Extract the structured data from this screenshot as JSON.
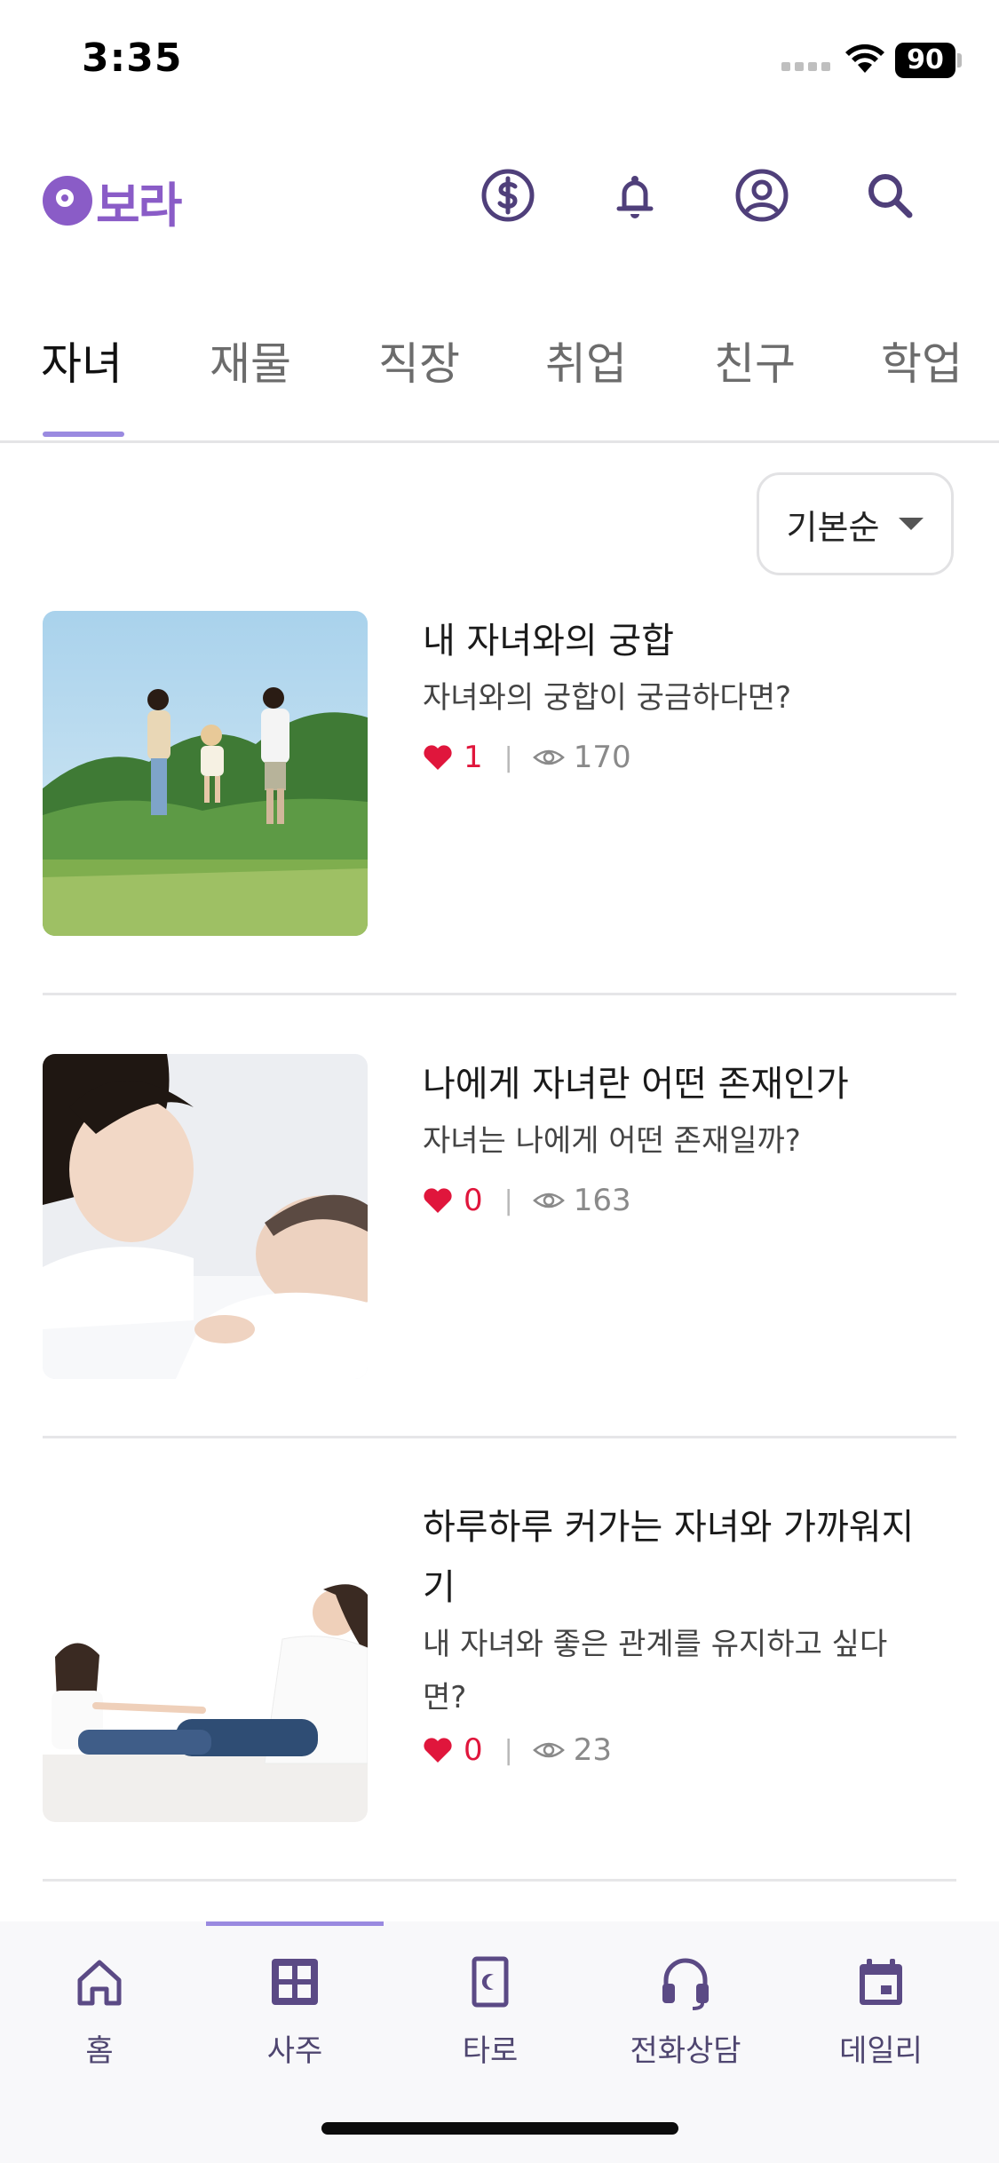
{
  "status_bar": {
    "time": "3:35",
    "battery": "90"
  },
  "header": {
    "logo_text": "보라",
    "icons": [
      "coin-icon",
      "bell-icon",
      "profile-icon",
      "search-icon"
    ]
  },
  "tabs": [
    "자녀",
    "재물",
    "직장",
    "취업",
    "친구",
    "학업"
  ],
  "active_tab": "자녀",
  "sort": {
    "label": "기본순"
  },
  "items": [
    {
      "title": "내 자녀와의 궁합",
      "title2": "",
      "desc": "자녀와의 궁합이 궁금하다면?",
      "desc2": "",
      "likes": "1",
      "views": "170"
    },
    {
      "title": "나에게 자녀란 어떤 존재인가",
      "title2": "",
      "desc": "자녀는 나에게 어떤 존재일까?",
      "desc2": "",
      "likes": "0",
      "views": "163"
    },
    {
      "title": "하루하루 커가는 자녀와 가까워지",
      "title2": "기",
      "desc": "내 자녀와 좋은 관계를 유지하고 싶다",
      "desc2": "면?",
      "likes": "0",
      "views": "23"
    }
  ],
  "bottom_nav": [
    {
      "label": "홈",
      "icon": "home-icon"
    },
    {
      "label": "사주",
      "icon": "grid-icon"
    },
    {
      "label": "타로",
      "icon": "tarot-card-icon"
    },
    {
      "label": "전화상담",
      "icon": "headset-icon"
    },
    {
      "label": "데일리",
      "icon": "calendar-icon"
    }
  ],
  "active_nav": "사주",
  "colors": {
    "brand": "#8a5cc7",
    "accent": "#9a8ae0",
    "like": "#e0163c",
    "icon": "#5b4a85"
  }
}
